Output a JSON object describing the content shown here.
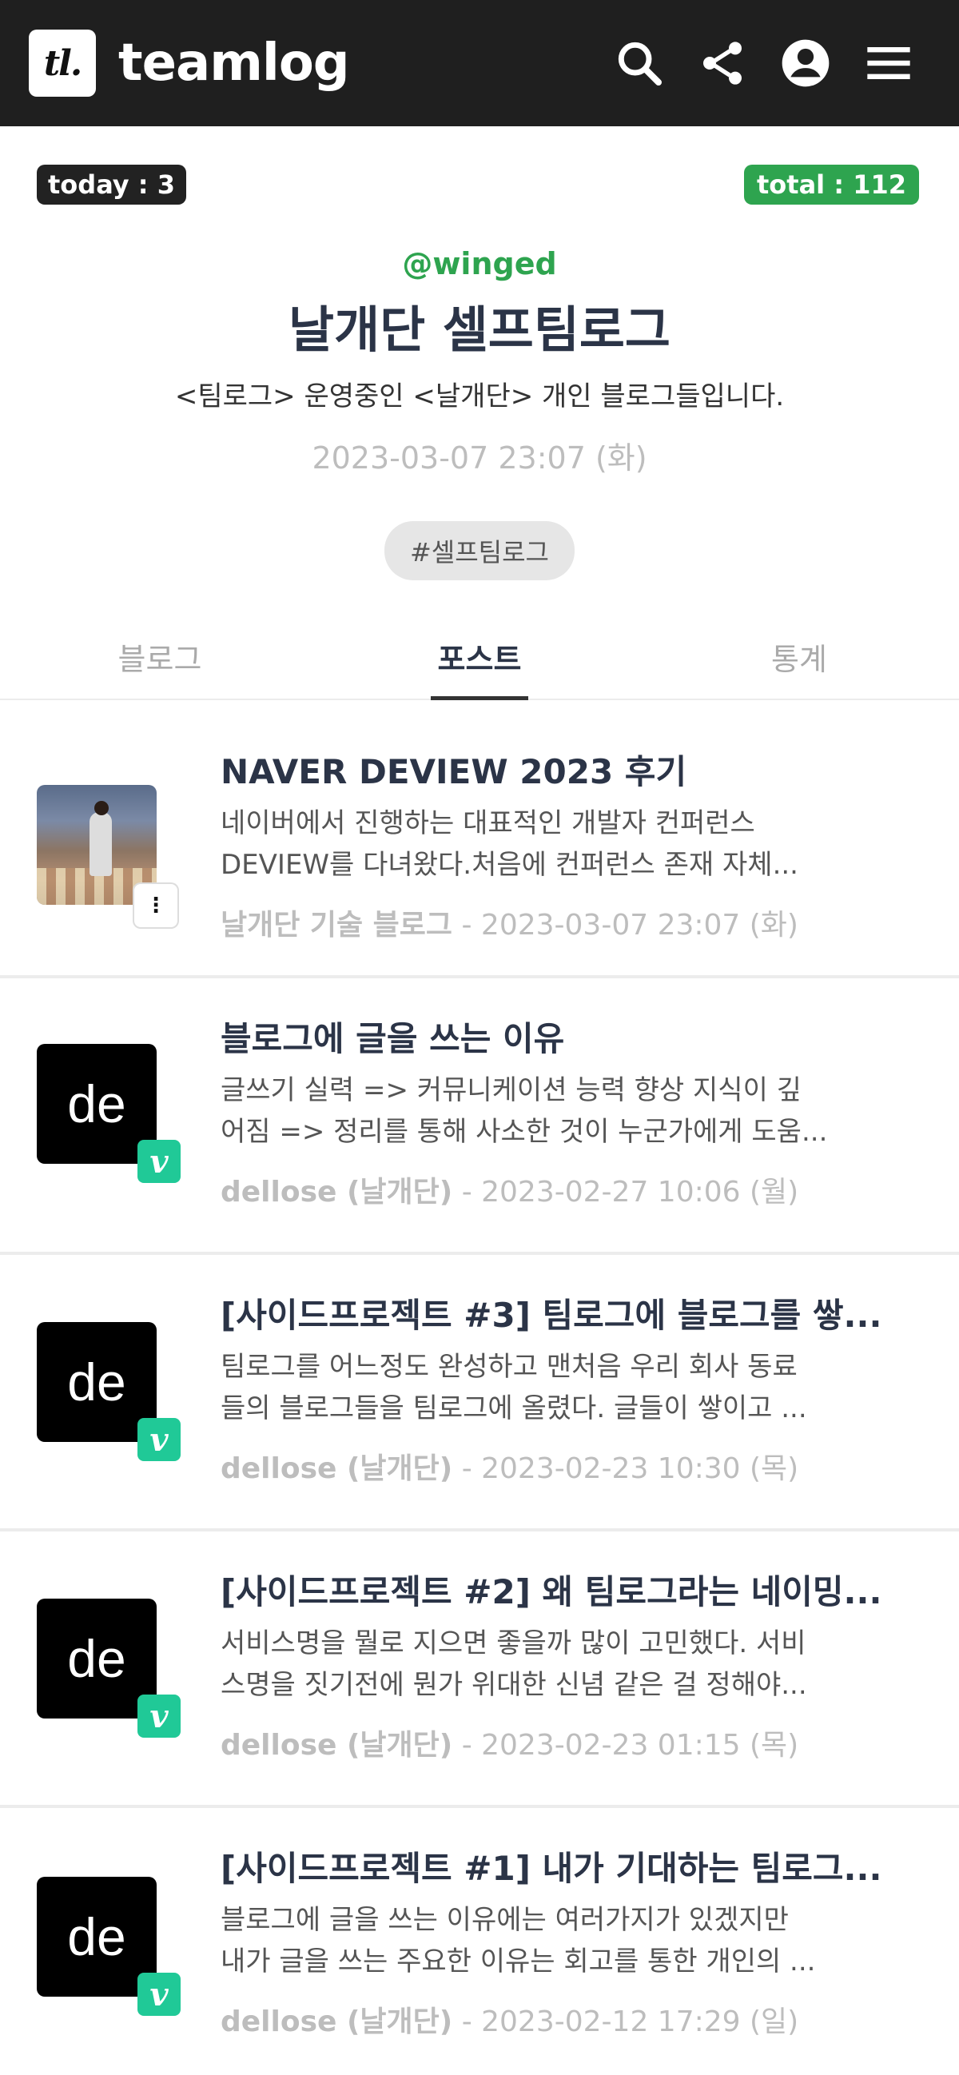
{
  "header": {
    "logo_text": "tl.",
    "brand": "teamlog",
    "icons": [
      "search-icon",
      "share-icon",
      "account-icon",
      "menu-icon"
    ]
  },
  "profile": {
    "today_label": "today : 3",
    "total_label": "total : 112",
    "handle": "@winged",
    "title": "날개단 셀프팀로그",
    "description": "<팀로그> 운영중인 <날개단> 개인 블로그들입니다.",
    "date": "2023-03-07 23:07 (화)",
    "tag": "#셀프팀로그"
  },
  "tabs": [
    {
      "label": "블로그",
      "active": false
    },
    {
      "label": "포스트",
      "active": true
    },
    {
      "label": "통계",
      "active": false
    }
  ],
  "posts": [
    {
      "title": "NAVER DEVIEW 2023 후기",
      "excerpt_line1": "네이버에서 진행하는 대표적인 개발자 컨퍼런스",
      "excerpt_line2": "DEVIEW를 다녀왔다.처음에 컨퍼런스 존재 자체...",
      "author": "날개단 기술 블로그",
      "date": " - 2023-03-07 23:07 (화)",
      "thumb": "photo",
      "badge": "tistory"
    },
    {
      "title": "블로그에 글을 쓰는 이유",
      "excerpt_line1": "글쓰기 실력 => 커뮤니케이션 능력 향상 지식이 깊",
      "excerpt_line2": "어짐 => 정리를 통해 사소한 것이 누군가에게 도움...",
      "author": "dellose (날개단)",
      "date": " - 2023-02-27 10:06 (월)",
      "thumb": "de",
      "badge": "velog"
    },
    {
      "title": "[사이드프로젝트 #3] 팀로그에 블로그를 쌓...",
      "excerpt_line1": "팀로그를 어느정도 완성하고 맨처음 우리 회사 동료",
      "excerpt_line2": "들의 블로그들을 팀로그에 올렸다. 글들이 쌓이고 ...",
      "author": "dellose (날개단)",
      "date": " - 2023-02-23 10:30 (목)",
      "thumb": "de",
      "badge": "velog"
    },
    {
      "title": "[사이드프로젝트 #2] 왜 팀로그라는 네이밍...",
      "excerpt_line1": "서비스명을 뭘로 지으면 좋을까 많이 고민했다. 서비",
      "excerpt_line2": "스명을 짓기전에 뭔가 위대한 신념 같은 걸 정해야...",
      "author": "dellose (날개단)",
      "date": " - 2023-02-23 01:15 (목)",
      "thumb": "de",
      "badge": "velog"
    },
    {
      "title": "[사이드프로젝트 #1] 내가 기대하는 팀로그...",
      "excerpt_line1": "블로그에 글을 쓰는 이유에는 여러가지가 있겠지만",
      "excerpt_line2": "내가 글을 쓰는 주요한 이유는 회고를 통한 개인의 ...",
      "author": "dellose (날개단)",
      "date": " - 2023-02-12 17:29 (일)",
      "thumb": "de",
      "badge": "velog"
    }
  ],
  "thumb_text": "de",
  "velog_badge": "v",
  "tistory_badge": "⋮",
  "colors": {
    "header_bg": "#1f1f1f",
    "accent": "#2ea44f",
    "velog": "#20c997"
  }
}
